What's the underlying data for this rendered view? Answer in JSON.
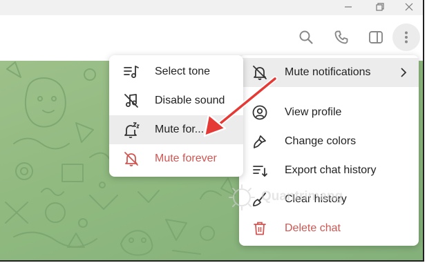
{
  "window_controls": {
    "minimize_icon": "minimize-icon",
    "maximize_icon": "restore-icon",
    "close_icon": "close-icon"
  },
  "header": {
    "search_icon": "search-icon",
    "call_icon": "phone-icon",
    "sidebar_icon": "sidebar-toggle-icon",
    "more_icon": "more-vertical-icon"
  },
  "main_menu": {
    "items": [
      {
        "label": "Mute notifications",
        "icon": "bell-off-icon",
        "has_submenu": true
      },
      {
        "label": "View profile",
        "icon": "profile-icon"
      },
      {
        "label": "Change colors",
        "icon": "brush-icon"
      },
      {
        "label": "Export chat history",
        "icon": "export-icon"
      },
      {
        "label": "Clear history",
        "icon": "broom-icon"
      },
      {
        "label": "Delete chat",
        "icon": "trash-icon",
        "danger": true
      }
    ]
  },
  "mute_submenu": {
    "items": [
      {
        "label": "Select tone",
        "icon": "music-list-icon"
      },
      {
        "label": "Disable sound",
        "icon": "note-off-icon"
      },
      {
        "label": "Mute for...",
        "icon": "bell-snooze-icon"
      },
      {
        "label": "Mute forever",
        "icon": "bell-off-icon",
        "danger": true
      }
    ]
  },
  "watermark": {
    "text": "Quantrimang"
  },
  "colors": {
    "accent_red": "#d05652",
    "chat_background": "#8fb97f",
    "annotation_arrow": "#e53935"
  }
}
